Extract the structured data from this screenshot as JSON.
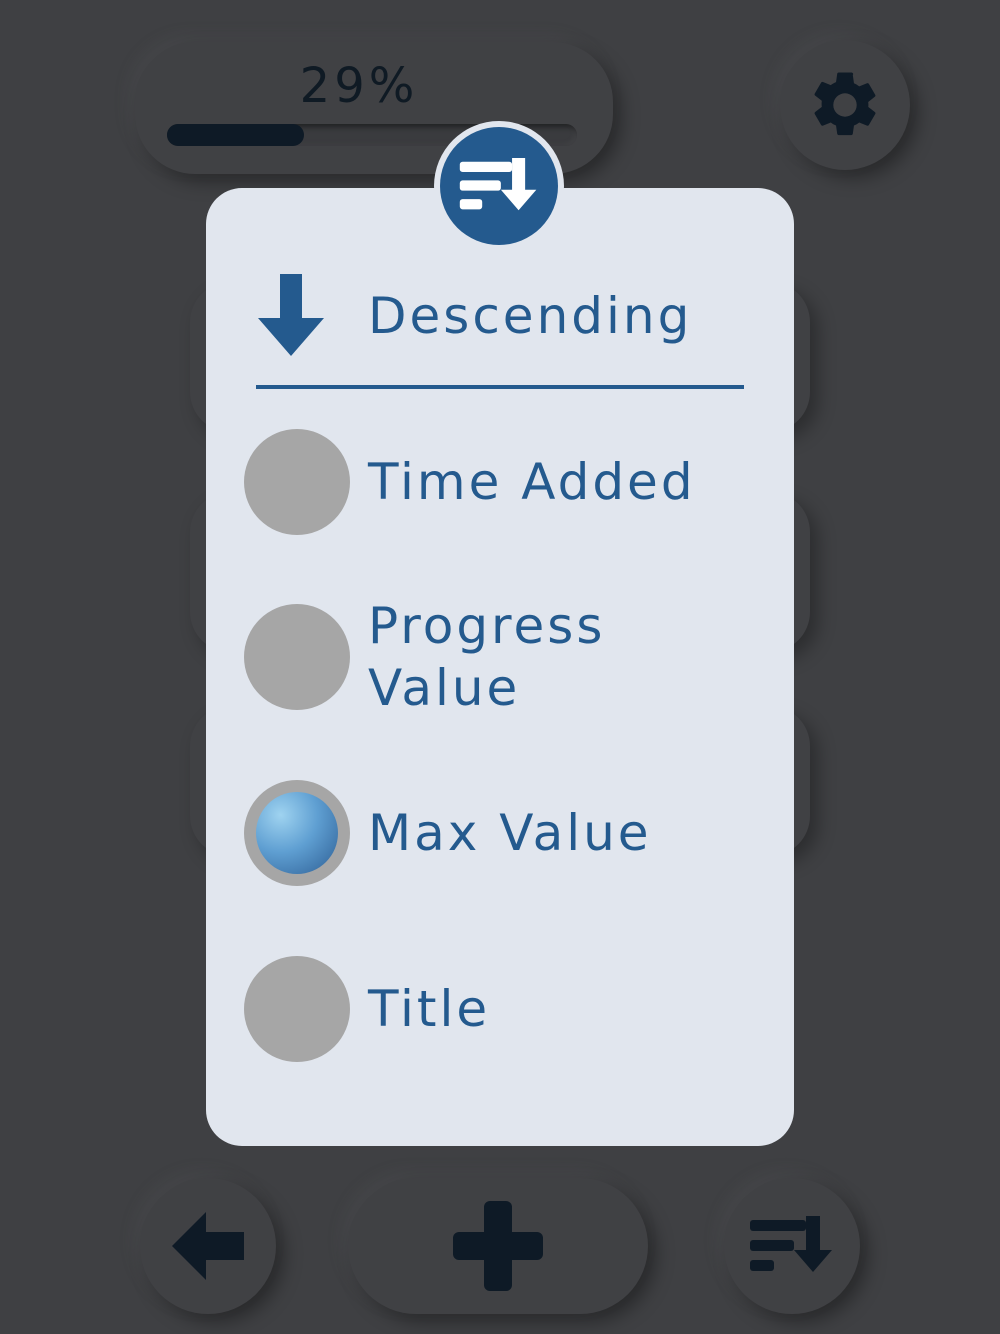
{
  "header": {
    "progress_text": "29%",
    "progress_value": 0.29,
    "settings_icon": "gear-icon"
  },
  "sort_popup": {
    "badge_icon": "sort-descending-icon",
    "order_icon": "arrow-down-icon",
    "order_label": "Descending",
    "options": [
      {
        "label": "Time Added",
        "selected": false
      },
      {
        "label": "Progress Value",
        "selected": false
      },
      {
        "label": "Max Value",
        "selected": true
      },
      {
        "label": "Title",
        "selected": false
      }
    ]
  },
  "bottom_bar": {
    "back_icon": "arrow-left-icon",
    "add_icon": "plus-icon",
    "sort_icon": "sort-descending-icon"
  },
  "colors": {
    "background": "#3f4043",
    "popup": "#e1e6ee",
    "accent": "#245a8e",
    "dark_icon": "#0e1a26",
    "radio_off": "#a6a6a6"
  }
}
